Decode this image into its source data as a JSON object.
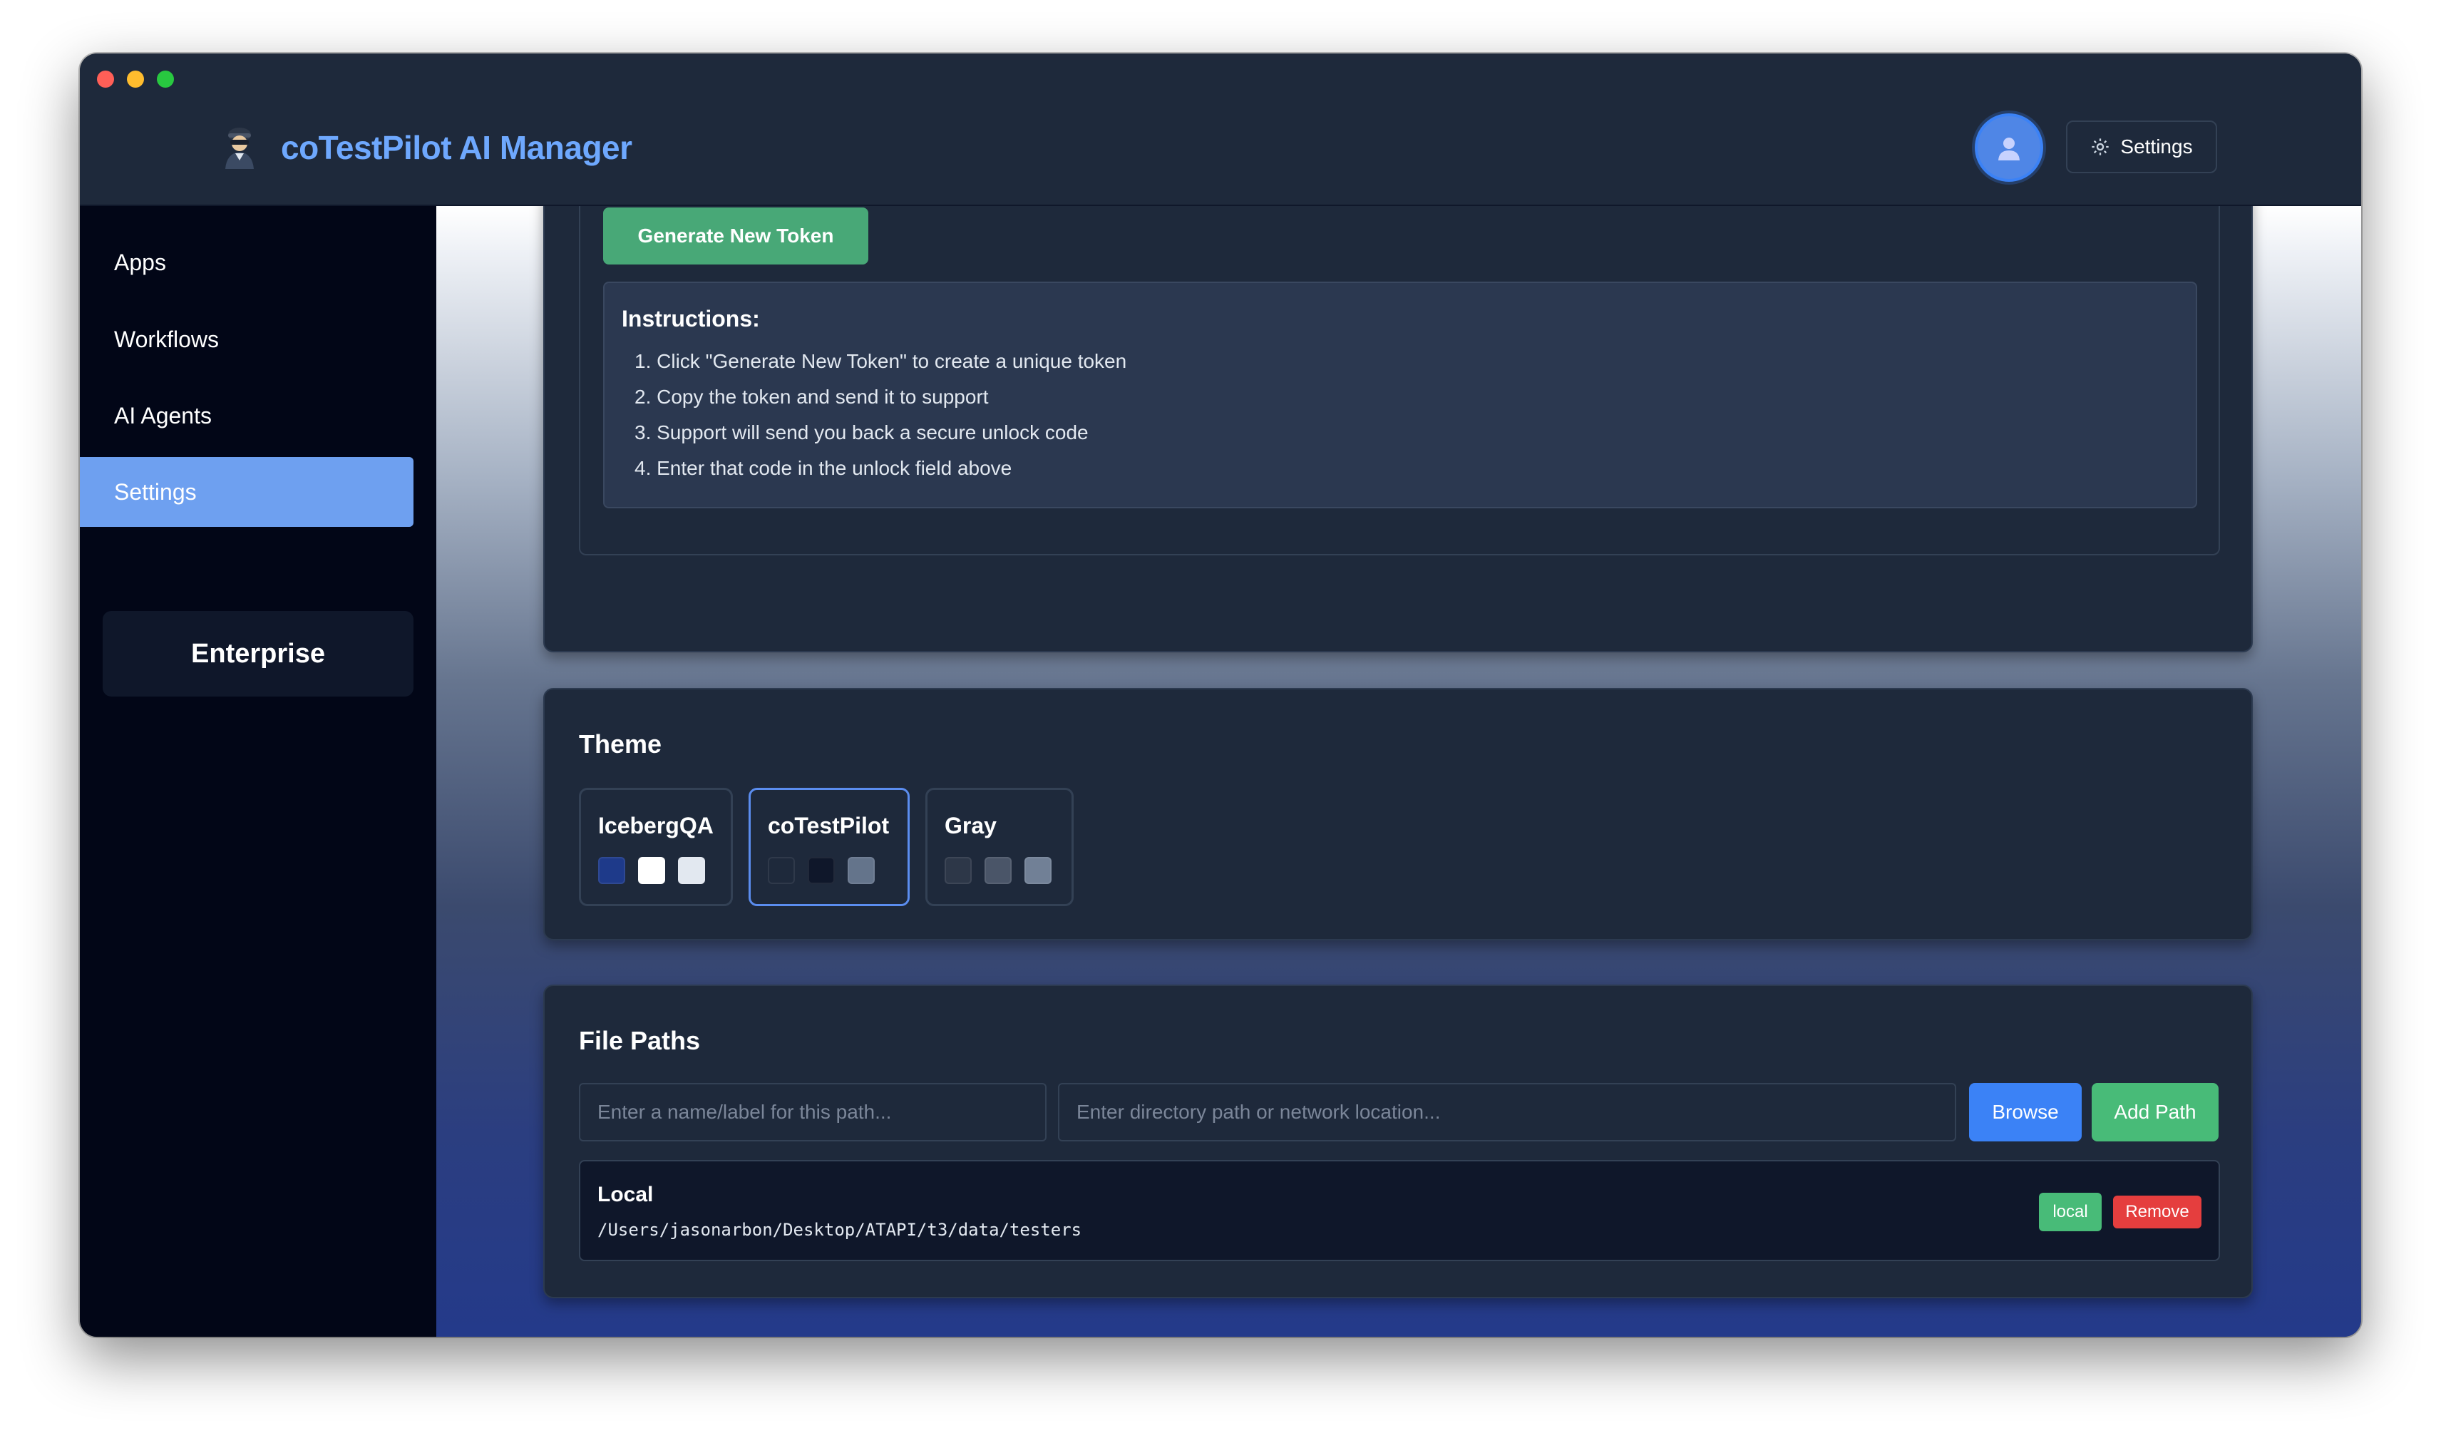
{
  "header": {
    "title": "coTestPilot AI Manager",
    "settings_label": "Settings",
    "icons": {
      "brand": "pilot-icon",
      "avatar": "user-icon",
      "settings": "gear-icon"
    }
  },
  "sidebar": {
    "items": [
      {
        "label": "Apps",
        "active": false
      },
      {
        "label": "Workflows",
        "active": false
      },
      {
        "label": "AI Agents",
        "active": false
      },
      {
        "label": "Settings",
        "active": true
      }
    ],
    "enterprise_label": "Enterprise"
  },
  "token": {
    "generate_label": "Generate New Token",
    "instructions_title": "Instructions:",
    "instructions": [
      "1. Click \"Generate New Token\" to create a unique token",
      "2. Copy the token and send it to support",
      "3. Support will send you back a secure unlock code",
      "4. Enter that code in the unlock field above"
    ]
  },
  "theme": {
    "title": "Theme",
    "selected": "coTestPilot",
    "options": [
      {
        "name": "IcebergQA",
        "colors": [
          "#1e3a8a",
          "#ffffff",
          "#e2e8f0"
        ]
      },
      {
        "name": "coTestPilot",
        "colors": [
          "#1e293b",
          "#0f172a",
          "#64748b"
        ]
      },
      {
        "name": "Gray",
        "colors": [
          "#2d3748",
          "#4a5568",
          "#718096"
        ]
      }
    ]
  },
  "file_paths": {
    "title": "File Paths",
    "name_placeholder": "Enter a name/label for this path...",
    "path_placeholder": "Enter directory path or network location...",
    "browse_label": "Browse",
    "add_label": "Add Path",
    "entries": [
      {
        "name": "Local",
        "path": "/Users/jasonarbon/Desktop/ATAPI/t3/data/testers",
        "type": "local",
        "remove_label": "Remove"
      }
    ]
  },
  "colors": {
    "accent": "#6ea8fe",
    "success": "#48bb78",
    "danger": "#e53e3e",
    "primary": "#3b82f6"
  }
}
